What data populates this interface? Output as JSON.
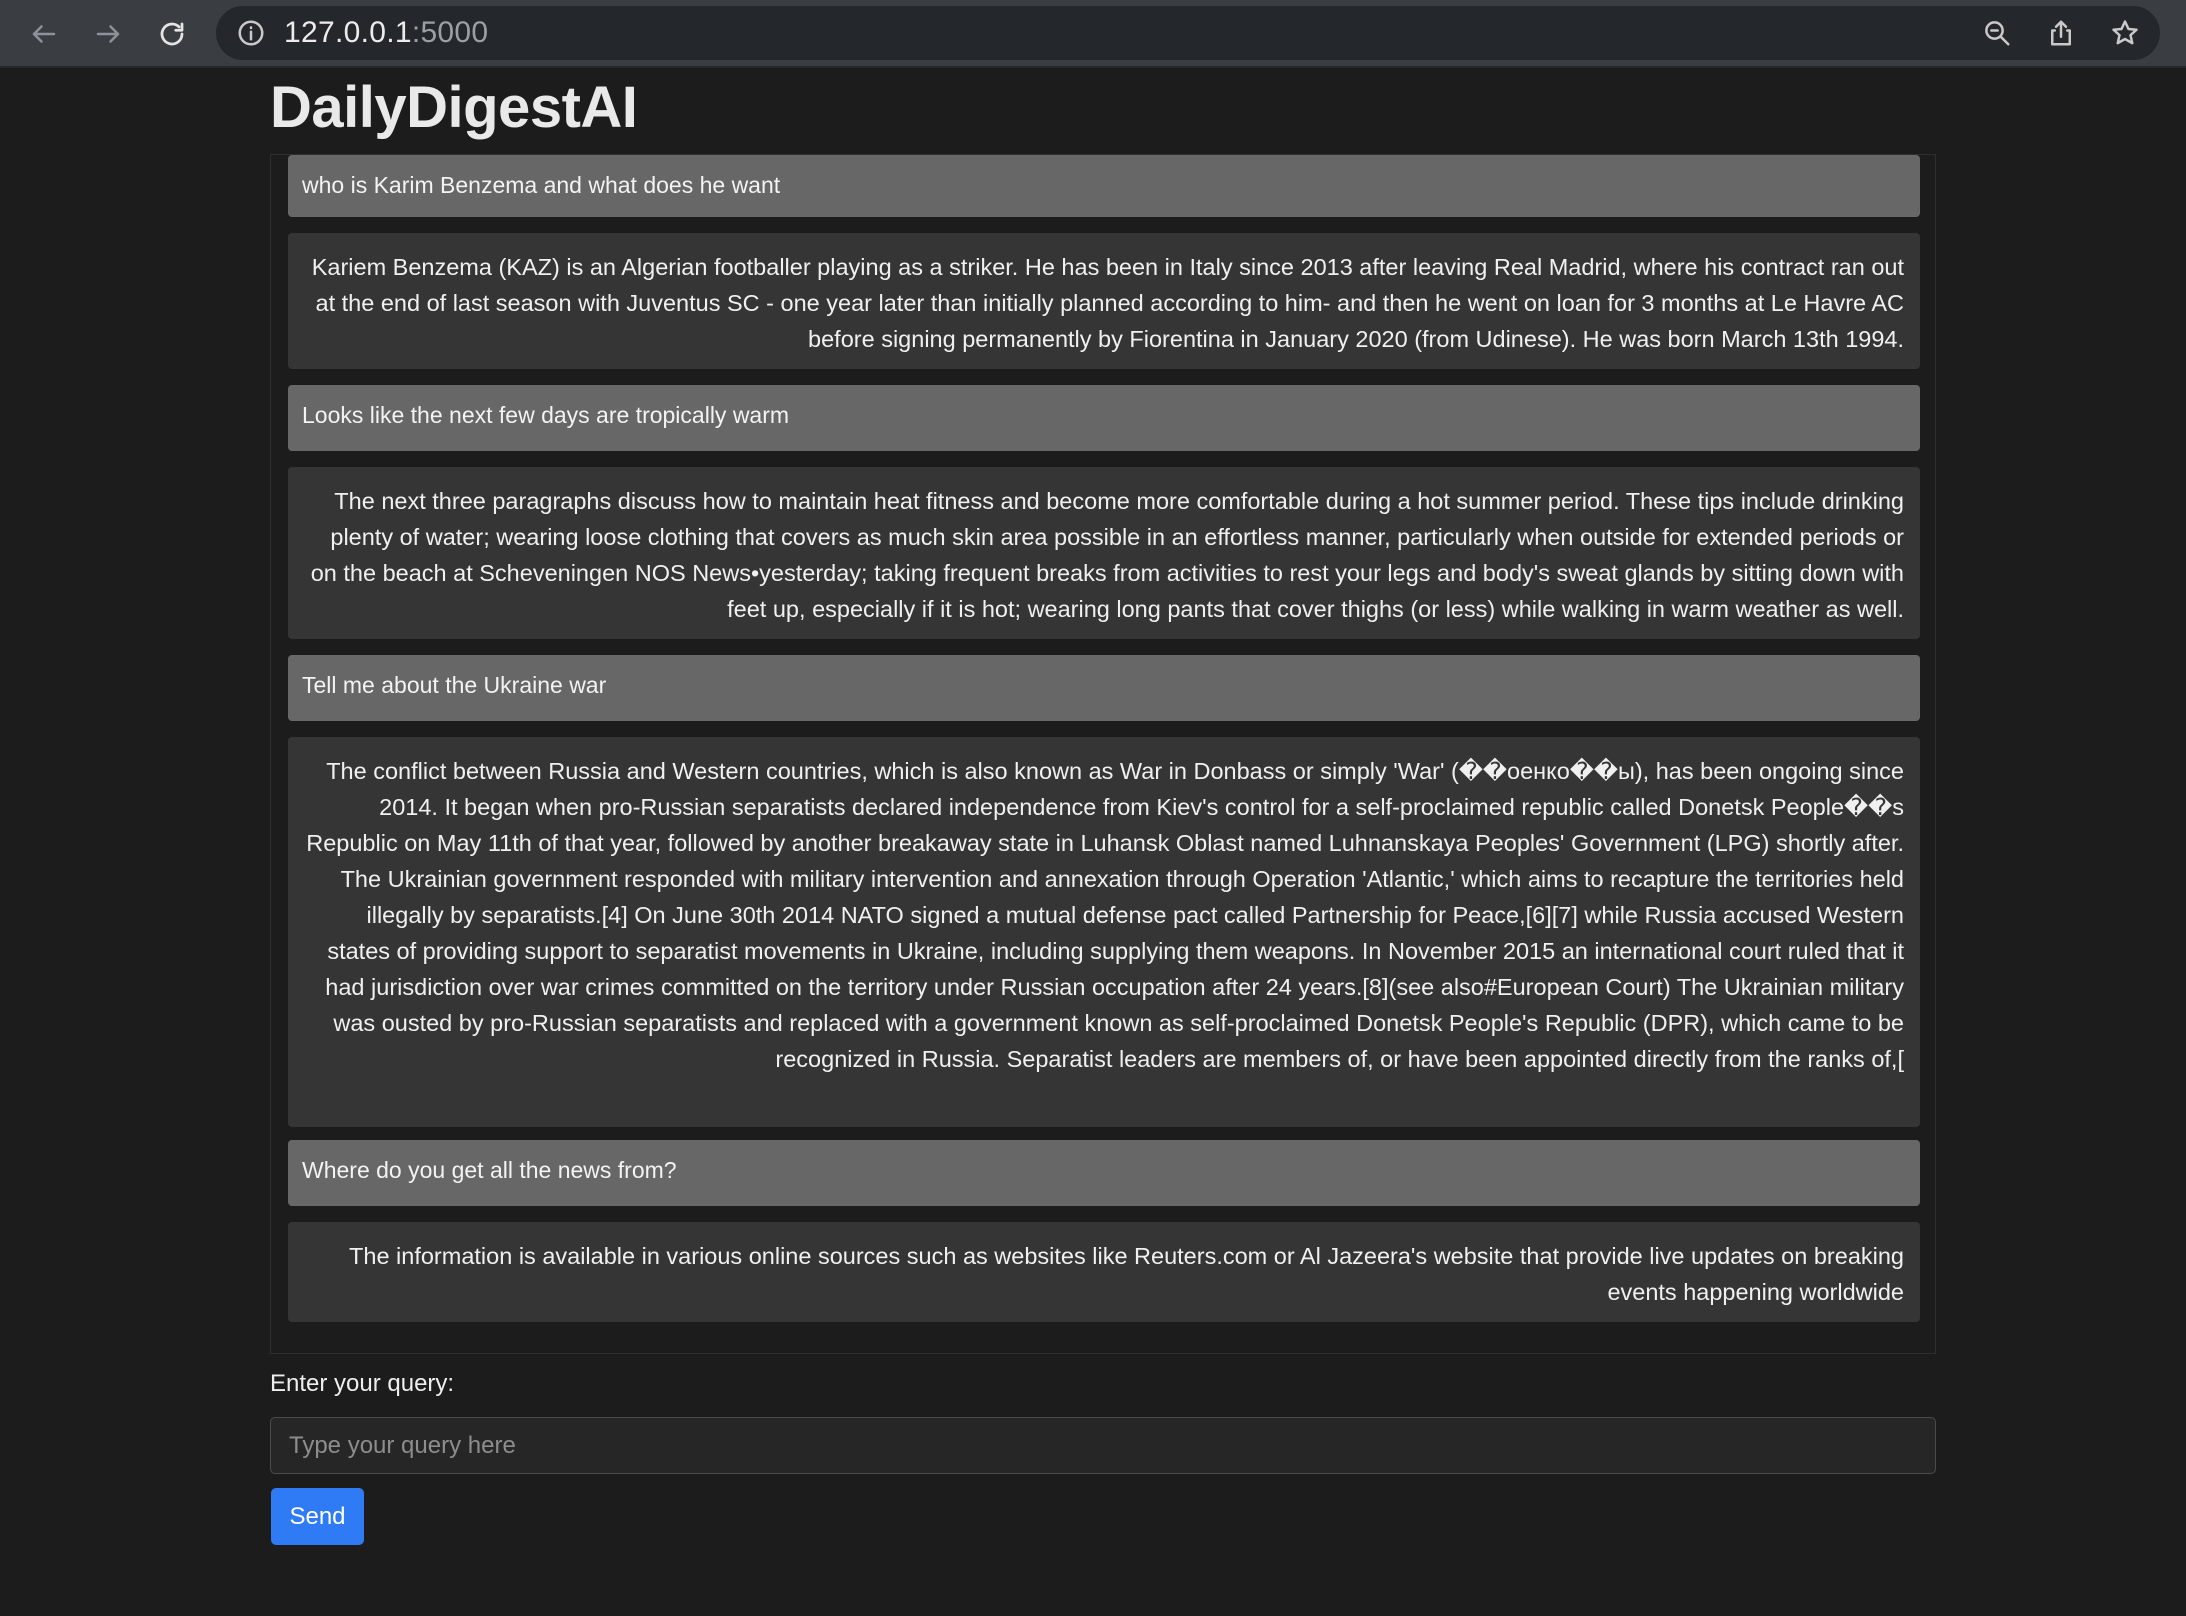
{
  "browser": {
    "url_host": "127.0.0.1",
    "url_port": ":5000",
    "icons": {
      "back": "arrow-left-icon",
      "forward": "arrow-right-icon",
      "reload": "reload-icon",
      "info": "info-icon",
      "zoom": "zoom-icon",
      "share": "share-icon",
      "bookmark": "star-icon"
    }
  },
  "page": {
    "title": "DailyDigestAI"
  },
  "messages": [
    {
      "role": "user",
      "text": "who is Karim Benzema and what does he want"
    },
    {
      "role": "bot",
      "text": "Kariem Benzema (KAZ) is an Algerian footballer playing as a striker. He has been in Italy since 2013 after leaving Real Madrid, where his contract ran out at the end of last season with Juventus SC - one year later than initially planned according to him- and then he went on loan for 3 months at Le Havre AC before signing permanently by Fiorentina in January 2020 (from Udinese). He was born March 13th 1994."
    },
    {
      "role": "user",
      "text": "Looks like the next few days are tropically warm"
    },
    {
      "role": "bot",
      "text": "The next three paragraphs discuss how to maintain heat fitness and become more comfortable during a hot summer period. These tips include drinking plenty of water; wearing loose clothing that covers as much skin area possible in an effortless manner, particularly when outside for extended periods or on the beach at Scheveningen NOS News•yesterday; taking frequent breaks from activities to rest your legs and body's sweat glands by sitting down with feet up, especially if it is hot; wearing long pants that cover thighs (or less) while walking in warm weather as well."
    },
    {
      "role": "user",
      "text": "Tell me about the Ukraine war"
    },
    {
      "role": "bot",
      "text": "The conflict between Russia and Western countries, which is also known as War in Donbass or simply 'War' (��оенко��ы), has been ongoing since 2014. It began when pro-Russian separatists declared independence from Kiev's control for a self-proclaimed republic called Donetsk People��s Republic on May 11th of that year, followed by another breakaway state in Luhansk Oblast named Luhnanskaya Peoples' Government (LPG) shortly after. The Ukrainian government responded with military intervention and annexation through Operation 'Atlantic,' which aims to recapture the territories held illegally by separatists.[4] On June 30th 2014 NATO signed a mutual defense pact called Partnership for Peace,[6][7] while Russia accused Western states of providing support to separatist movements in Ukraine, including supplying them weapons. In November 2015 an international court ruled that it had jurisdiction over war crimes committed on the territory under Russian occupation after 24 years.[8](see also#European Court) The Ukrainian military was ousted by pro-Russian separatists and replaced with a government known as self-proclaimed Donetsk People's Republic (DPR), which came to be recognized in Russia. Separatist leaders are members of, or have been appointed directly from the ranks of,["
    },
    {
      "role": "user",
      "text": "Where do you get all the news from?"
    },
    {
      "role": "bot",
      "text": "The information is available in various online sources such as websites like Reuters.com or Al Jazeera's website that provide live updates on breaking events happening worldwide"
    }
  ],
  "form": {
    "label": "Enter your query:",
    "placeholder": "Type your query here",
    "value": "",
    "send_label": "Send"
  },
  "colors": {
    "background": "#1c1c1d",
    "user_bubble": "#676767",
    "bot_bubble": "#353536",
    "send_button": "#2f7bf5"
  }
}
